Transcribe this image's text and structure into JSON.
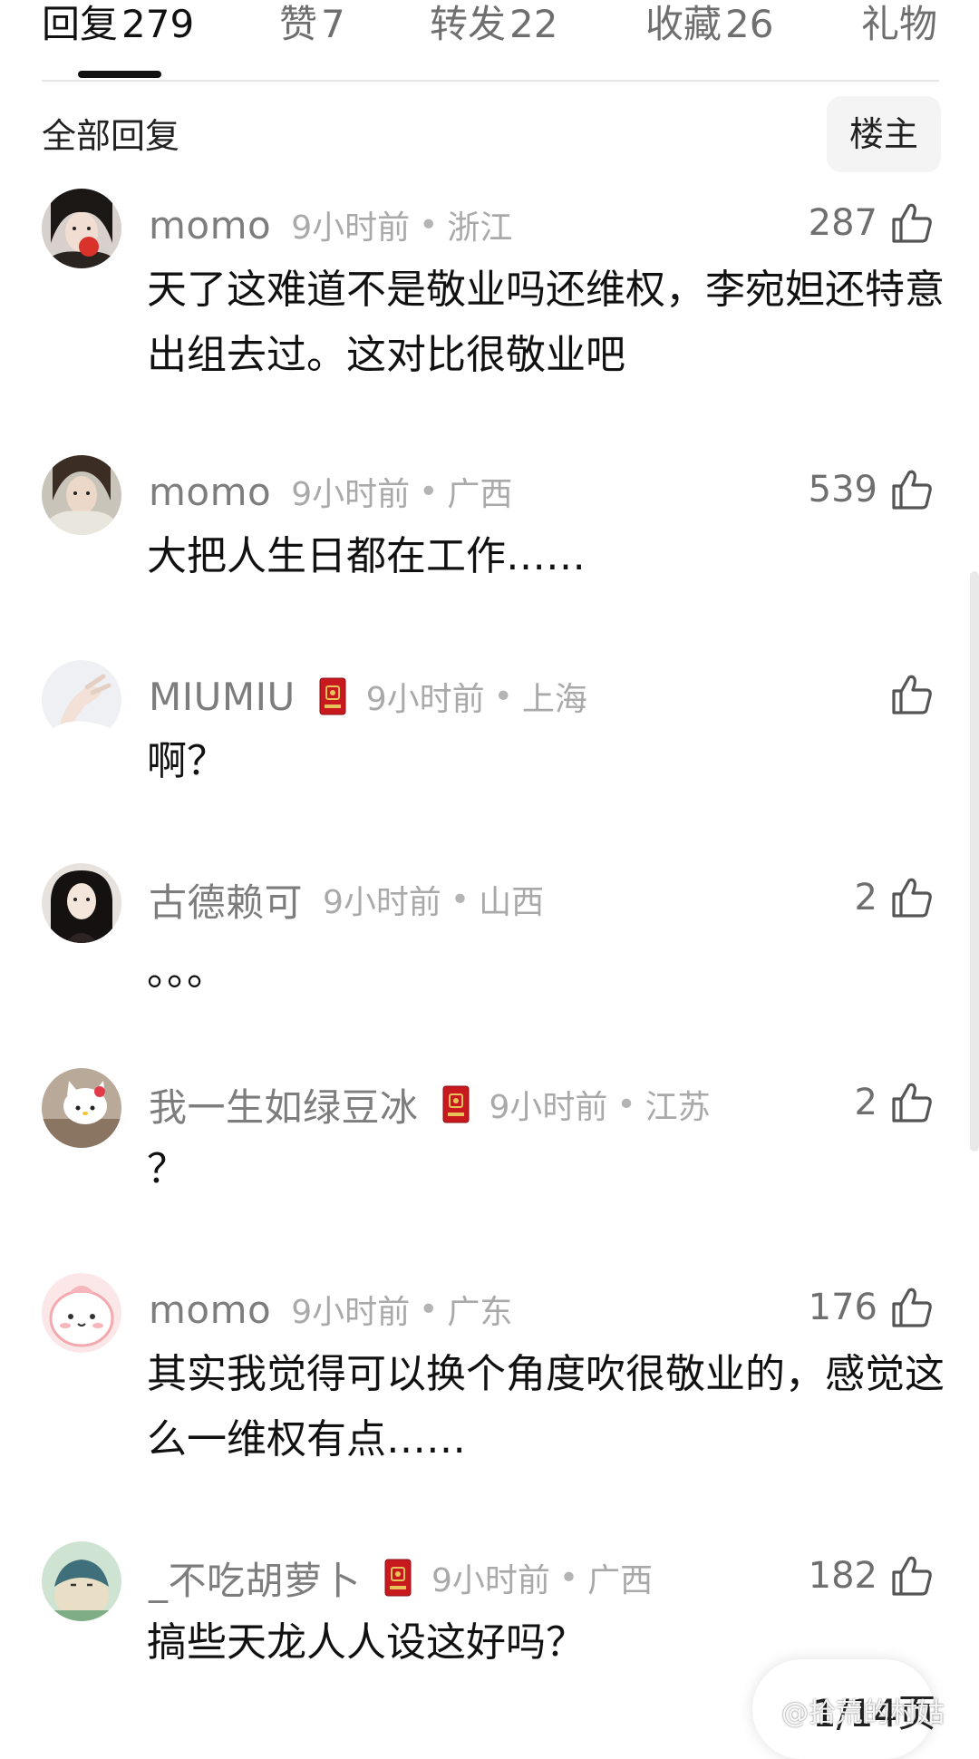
{
  "tabs": [
    {
      "label": "回复",
      "count": "279",
      "active": true
    },
    {
      "label": "赞",
      "count": "7",
      "active": false
    },
    {
      "label": "转发",
      "count": "22",
      "active": false
    },
    {
      "label": "收藏",
      "count": "26",
      "active": false
    },
    {
      "label": "礼物",
      "count": "",
      "active": false
    }
  ],
  "subheader": {
    "title": "全部回复",
    "op_filter": "楼主"
  },
  "comments": [
    {
      "username": "momo",
      "time": "9小时前",
      "region": "浙江",
      "likes": "287",
      "text": "天了这难道不是敬业吗还维权，李宛妲还特意出组去过。这对比很敬业吧",
      "badge": false,
      "avatar_icon": "avatar-girl-with-apple"
    },
    {
      "username": "momo",
      "time": "9小时前",
      "region": "广西",
      "likes": "539",
      "text": "大把人生日都在工作……",
      "badge": false,
      "avatar_icon": "avatar-girl-scarf"
    },
    {
      "username": "MIUMIU",
      "time": "9小时前",
      "region": "上海",
      "likes": "",
      "text": "啊？",
      "badge": true,
      "avatar_icon": "avatar-hand"
    },
    {
      "username": "古德赖可",
      "time": "9小时前",
      "region": "山西",
      "likes": "2",
      "text": "。。。",
      "badge": false,
      "avatar_icon": "avatar-girl-dark-hair"
    },
    {
      "username": "我一生如绿豆冰",
      "time": "9小时前",
      "region": "江苏",
      "likes": "2",
      "text": "？",
      "badge": true,
      "avatar_icon": "avatar-hello-kitty"
    },
    {
      "username": "momo",
      "time": "9小时前",
      "region": "广东",
      "likes": "176",
      "text": "其实我觉得可以换个角度吹很敬业的，感觉这么一维权有点……",
      "badge": false,
      "avatar_icon": "avatar-pink-cartoon"
    },
    {
      "username": "_不吃胡萝卜",
      "time": "9小时前",
      "region": "广西",
      "likes": "182",
      "text": "搞些天龙人人设这好吗？",
      "badge": true,
      "avatar_icon": "avatar-snorlax"
    }
  ],
  "page_indicator": "1/14页",
  "watermark": "@拾荒的村姑",
  "colors": {
    "text_primary": "#111111",
    "text_secondary": "#7d7d7d",
    "text_meta": "#a9a9a9",
    "badge_red": "#c8191f",
    "badge_gold": "#e8c25a"
  }
}
